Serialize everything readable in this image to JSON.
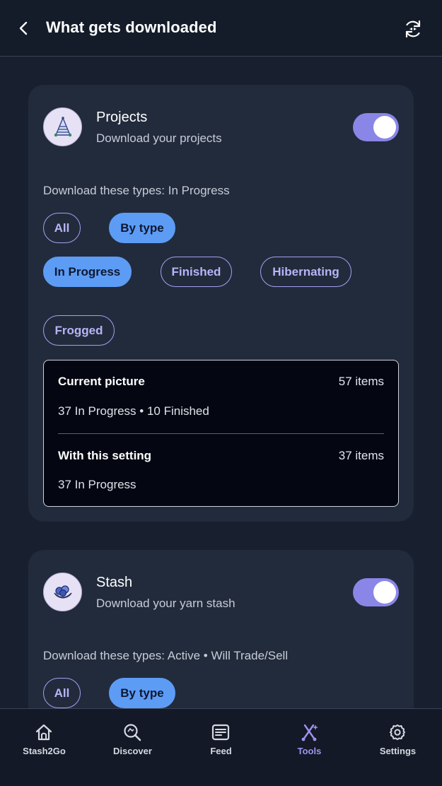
{
  "header": {
    "title": "What gets downloaded"
  },
  "projects": {
    "title": "Projects",
    "subtitle": "Download your projects",
    "enabled": true,
    "types_line": "Download these types: In Progress",
    "mode_chips": [
      {
        "label": "All",
        "selected": false
      },
      {
        "label": "By type",
        "selected": true
      }
    ],
    "type_chips": [
      {
        "label": "In Progress",
        "selected": true
      },
      {
        "label": "Finished",
        "selected": false
      },
      {
        "label": "Hibernating",
        "selected": false
      },
      {
        "label": "Frogged",
        "selected": false
      }
    ],
    "summary": {
      "current_label": "Current picture",
      "current_count": "57 items",
      "current_detail": "37 In Progress • 10 Finished",
      "setting_label": "With this setting",
      "setting_count": "37 items",
      "setting_detail": "37 In Progress"
    }
  },
  "stash": {
    "title": "Stash",
    "subtitle": "Download your yarn stash",
    "enabled": true,
    "types_line": "Download these types: Active • Will Trade/Sell",
    "mode_chips": [
      {
        "label": "All",
        "selected": false
      },
      {
        "label": "By type",
        "selected": true
      }
    ]
  },
  "nav": {
    "items": [
      {
        "label": "Stash2Go",
        "icon": "home-icon",
        "active": false
      },
      {
        "label": "Discover",
        "icon": "search-icon",
        "active": false
      },
      {
        "label": "Feed",
        "icon": "feed-icon",
        "active": false
      },
      {
        "label": "Tools",
        "icon": "tools-icon",
        "active": true
      },
      {
        "label": "Settings",
        "icon": "gear-icon",
        "active": false
      }
    ]
  },
  "colors": {
    "accent": "#8a86e8",
    "selected_chip": "#5d9cf5",
    "active_nav": "#9e93ee",
    "background": "#18202f",
    "card": "#222b3c"
  }
}
